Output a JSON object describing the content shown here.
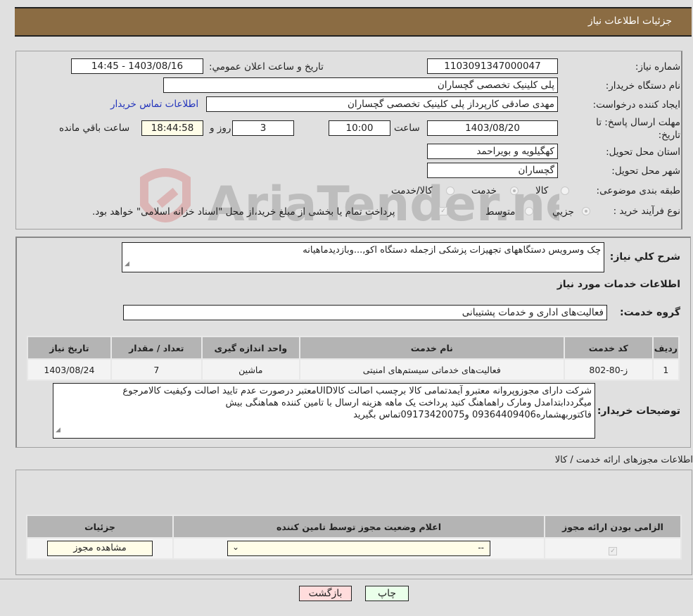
{
  "header": {
    "title": "جزئیات اطلاعات نیاز"
  },
  "form": {
    "need_number": {
      "label": "شماره نیاز:",
      "value": "1103091347000047"
    },
    "announce_datetime": {
      "label": "تاریخ و ساعت اعلان عمومي:",
      "value": "1403/08/16 - 14:45"
    },
    "buyer_org": {
      "label": "نام دستگاه خریدار:",
      "value": "پلی کلینیک تخصصی گچساران"
    },
    "creator": {
      "label": "ایجاد کننده درخواست:",
      "value": "مهدی صادقی کارپرداز پلی کلینیک تخصصی گچساران",
      "contact_link": "اطلاعات تماس خریدار"
    },
    "deadline": {
      "label": "مهلت ارسال پاسخ: تا تاریخ:",
      "date": "1403/08/20",
      "time_label": "ساعت",
      "time": "10:00",
      "days": "3",
      "days_label": "روز و",
      "remaining": "18:44:58",
      "remaining_label": "ساعت باقي مانده"
    },
    "province": {
      "label": "استان محل تحویل:",
      "value": "کهگیلویه و بویراحمد"
    },
    "city": {
      "label": "شهر محل تحویل:",
      "value": "گچساران"
    },
    "category": {
      "label": "طبقه بندی موضوعی:",
      "options": [
        "کالا",
        "خدمت",
        "کالا/خدمت"
      ],
      "selected": "خدمت"
    },
    "purchase_type": {
      "label": "نوع فرآیند خرید :",
      "options": [
        "جزيي",
        "متوسط"
      ],
      "selected": "جزيي",
      "treasury_note": "پرداخت تمام یا بخشی از مبلغ خرید،از محل \"اسناد خزانه اسلامی\" خواهد بود."
    }
  },
  "description": {
    "label": "شرح کلي نياز:",
    "value": "چک وسرویس دستگاههای تجهیزات پزشکی ازجمله دستگاه اکو,...وبازدیدماهیانه"
  },
  "services": {
    "section_title": "اطلاعات خدمات مورد نیاز",
    "group_label": "گروه خدمت:",
    "group_value": "فعالیت‌های اداری و خدمات پشتیبانی",
    "columns": [
      "ردیف",
      "کد خدمت",
      "نام خدمت",
      "واحد اندازه گیری",
      "تعداد / مقدار",
      "تاریخ نیاز"
    ],
    "rows": [
      [
        "1",
        "ز-80-802",
        "فعالیت‌های خدماتی سیستم‌های امنیتی",
        "ماشین",
        "7",
        "1403/08/24"
      ]
    ]
  },
  "buyer_notes": {
    "label": "توضیحات خریدار:",
    "lines": [
      "شرکت دارای مجوزوپروانه معتبرو آیمدتمامی کالا برچسب اصالت کالاUIDمعتبر درصورت عدم تایید اصالت وکیفیت کالامرجوع",
      "میگرددابتدامدل ومارک راهماهنگ کنید پرداخت یک ماهه هزینه ارسال با تامین کننده هماهنگی بیش",
      "فاکتوربهشماره09364409406 و09173420075تماس بگیرید"
    ]
  },
  "permits": {
    "section_title": "اطلاعات مجوزهای ارائه خدمت / کالا",
    "columns": [
      "الزامی بودن ارائه مجوز",
      "اعلام وضعیت مجوز توسط تامین کننده",
      "جزئیات"
    ],
    "row": {
      "required": true,
      "status_selected": "--",
      "details_button": "مشاهده مجوز"
    }
  },
  "footer": {
    "print_label": "چاپ",
    "back_label": "بازگشت"
  },
  "watermark": {
    "text": "AriaTender.neT"
  },
  "colors": {
    "header_bg": "#8b6c43",
    "link": "#2233bb",
    "print_bg": "#eaffea",
    "back_bg": "#ffdcdc",
    "highlight_field": "#fffde8"
  }
}
